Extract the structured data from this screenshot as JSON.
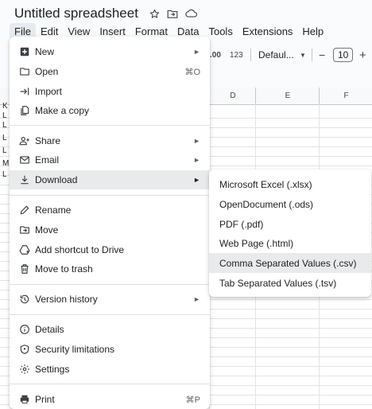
{
  "doc": {
    "title": "Untitled spreadsheet"
  },
  "title_icons": [
    "star-icon",
    "move-to-folder-icon",
    "cloud-status-icon"
  ],
  "menubar": [
    "File",
    "Edit",
    "View",
    "Insert",
    "Format",
    "Data",
    "Tools",
    "Extensions",
    "Help"
  ],
  "toolbar": {
    "decimal_increase": ".00",
    "number_format": "123",
    "font_family": "Defaul...",
    "minus": "−",
    "font_size": "10",
    "plus": "+"
  },
  "grid": {
    "column_headers": [
      "D",
      "E",
      "F"
    ],
    "row_stubs": [
      "K",
      "L",
      "L",
      "L",
      "L",
      "M",
      "L"
    ]
  },
  "file_menu": {
    "items": [
      {
        "id": "new",
        "label": "New",
        "icon": "add-box-icon",
        "has_submenu": true
      },
      {
        "id": "open",
        "label": "Open",
        "icon": "folder-icon",
        "shortcut": "⌘O"
      },
      {
        "id": "import",
        "label": "Import",
        "icon": "import-arrow-icon"
      },
      {
        "id": "copy",
        "label": "Make a copy",
        "icon": "copy-document-icon"
      },
      {
        "id": "share",
        "label": "Share",
        "icon": "share-person-icon",
        "has_submenu": true
      },
      {
        "id": "email",
        "label": "Email",
        "icon": "mail-icon",
        "has_submenu": true
      },
      {
        "id": "download",
        "label": "Download",
        "icon": "download-icon",
        "has_submenu": true,
        "highlighted": true
      },
      {
        "id": "rename",
        "label": "Rename",
        "icon": "pencil-icon"
      },
      {
        "id": "move",
        "label": "Move",
        "icon": "move-folder-icon"
      },
      {
        "id": "shortcut",
        "label": "Add shortcut to Drive",
        "icon": "drive-shortcut-icon"
      },
      {
        "id": "trash",
        "label": "Move to trash",
        "icon": "trash-icon"
      },
      {
        "id": "version",
        "label": "Version history",
        "icon": "history-icon",
        "has_submenu": true
      },
      {
        "id": "details",
        "label": "Details",
        "icon": "info-icon"
      },
      {
        "id": "security",
        "label": "Security limitations",
        "icon": "shield-icon"
      },
      {
        "id": "settings",
        "label": "Settings",
        "icon": "gear-icon"
      },
      {
        "id": "print",
        "label": "Print",
        "icon": "printer-icon",
        "shortcut": "⌘P"
      }
    ],
    "submenu_arrow": "►"
  },
  "download_submenu": {
    "items": [
      {
        "label": "Microsoft Excel (.xlsx)"
      },
      {
        "label": "OpenDocument (.ods)"
      },
      {
        "label": "PDF (.pdf)"
      },
      {
        "label": "Web Page (.html)"
      },
      {
        "label": "Comma Separated Values (.csv)",
        "highlighted": true
      },
      {
        "label": "Tab Separated Values (.tsv)"
      }
    ]
  },
  "colors": {
    "background": "#f9fbfd",
    "hover": "#e9eaeb",
    "active_menu": "#e6eaf1",
    "text": "#1f1f1f"
  }
}
